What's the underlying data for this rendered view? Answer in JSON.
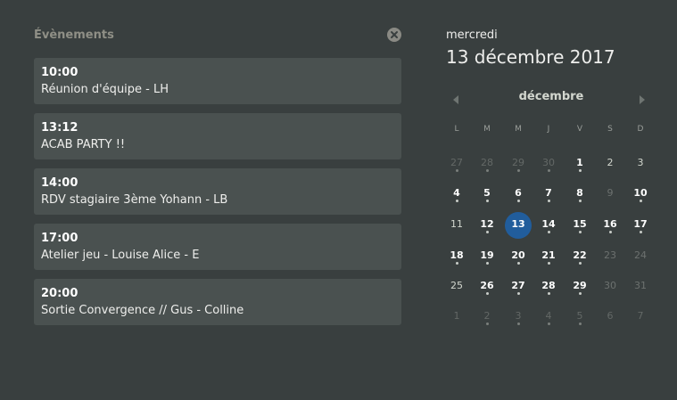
{
  "events": {
    "title": "Évènements",
    "items": [
      {
        "time": "10:00",
        "desc": "Réunion d'équipe - LH"
      },
      {
        "time": "13:12",
        "desc": "ACAB PARTY !!"
      },
      {
        "time": "14:00",
        "desc": "RDV stagiaire 3ème Yohann - LB"
      },
      {
        "time": "17:00",
        "desc": "Atelier jeu - Louise Alice - E"
      },
      {
        "time": "20:00",
        "desc": "Sortie Convergence // Gus - Colline"
      }
    ]
  },
  "calendar": {
    "day_name": "mercredi",
    "full_date": "13 décembre 2017",
    "month": "décembre",
    "weekdays": [
      "L",
      "M",
      "M",
      "J",
      "V",
      "S",
      "D"
    ],
    "weeks": [
      [
        {
          "d": "27",
          "s": "other",
          "e": true
        },
        {
          "d": "28",
          "s": "other",
          "e": true
        },
        {
          "d": "29",
          "s": "other",
          "e": true
        },
        {
          "d": "30",
          "s": "other",
          "e": true
        },
        {
          "d": "1",
          "s": "bold",
          "e": true
        },
        {
          "d": "2",
          "s": "normal",
          "e": false
        },
        {
          "d": "3",
          "s": "normal",
          "e": false
        }
      ],
      [
        {
          "d": "4",
          "s": "bold",
          "e": true
        },
        {
          "d": "5",
          "s": "bold",
          "e": true
        },
        {
          "d": "6",
          "s": "bold",
          "e": true
        },
        {
          "d": "7",
          "s": "bold",
          "e": true
        },
        {
          "d": "8",
          "s": "bold",
          "e": true
        },
        {
          "d": "9",
          "s": "dim",
          "e": false
        },
        {
          "d": "10",
          "s": "bold",
          "e": true
        }
      ],
      [
        {
          "d": "11",
          "s": "normal",
          "e": false
        },
        {
          "d": "12",
          "s": "bold",
          "e": true
        },
        {
          "d": "13",
          "s": "today",
          "e": false
        },
        {
          "d": "14",
          "s": "bold",
          "e": true
        },
        {
          "d": "15",
          "s": "bold",
          "e": true
        },
        {
          "d": "16",
          "s": "bold",
          "e": true
        },
        {
          "d": "17",
          "s": "bold",
          "e": true
        }
      ],
      [
        {
          "d": "18",
          "s": "bold",
          "e": true
        },
        {
          "d": "19",
          "s": "bold",
          "e": true
        },
        {
          "d": "20",
          "s": "bold",
          "e": true
        },
        {
          "d": "21",
          "s": "bold",
          "e": true
        },
        {
          "d": "22",
          "s": "bold",
          "e": true
        },
        {
          "d": "23",
          "s": "dim",
          "e": false
        },
        {
          "d": "24",
          "s": "dim",
          "e": false
        }
      ],
      [
        {
          "d": "25",
          "s": "normal",
          "e": false
        },
        {
          "d": "26",
          "s": "bold",
          "e": true
        },
        {
          "d": "27",
          "s": "bold",
          "e": true
        },
        {
          "d": "28",
          "s": "bold",
          "e": true
        },
        {
          "d": "29",
          "s": "bold",
          "e": true
        },
        {
          "d": "30",
          "s": "dim",
          "e": false
        },
        {
          "d": "31",
          "s": "dim",
          "e": false
        }
      ],
      [
        {
          "d": "1",
          "s": "other",
          "e": false
        },
        {
          "d": "2",
          "s": "other",
          "e": true
        },
        {
          "d": "3",
          "s": "other",
          "e": true
        },
        {
          "d": "4",
          "s": "other",
          "e": true
        },
        {
          "d": "5",
          "s": "other",
          "e": true
        },
        {
          "d": "6",
          "s": "other",
          "e": false
        },
        {
          "d": "7",
          "s": "other",
          "e": false
        }
      ]
    ]
  },
  "icons": {
    "close": "close-icon",
    "prev": "chevron-left-icon",
    "next": "chevron-right-icon"
  },
  "colors": {
    "background": "#393f3f",
    "card": "#4a5150",
    "today": "#215d9c"
  }
}
